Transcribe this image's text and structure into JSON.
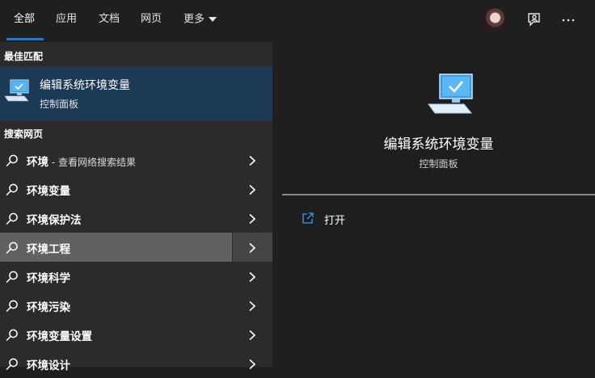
{
  "tabs": [
    {
      "label": "全部"
    },
    {
      "label": "应用"
    },
    {
      "label": "文档"
    },
    {
      "label": "网页"
    },
    {
      "label": "更多"
    }
  ],
  "sections": {
    "best_match": "最佳匹配",
    "web_search": "搜索网页"
  },
  "best_match": {
    "title": "编辑系统环境变量",
    "subtitle": "控制面板"
  },
  "web_results": [
    {
      "label": "环境",
      "suffix": " - 查看网络搜索结果"
    },
    {
      "label": "环境变量",
      "suffix": ""
    },
    {
      "label": "环境保护法",
      "suffix": ""
    },
    {
      "label": "环境工程",
      "suffix": "",
      "highlighted": true
    },
    {
      "label": "环境科学",
      "suffix": ""
    },
    {
      "label": "环境污染",
      "suffix": ""
    },
    {
      "label": "环境变量设置",
      "suffix": ""
    },
    {
      "label": "环境设计",
      "suffix": ""
    }
  ],
  "detail": {
    "title": "编辑系统环境变量",
    "subtitle": "控制面板",
    "actions": [
      {
        "label": "打开",
        "icon": "open-icon"
      }
    ]
  },
  "colors": {
    "accent": "#1a7ad4",
    "best_match_bg": "#1c3a56",
    "highlight_bg": "#616161"
  }
}
